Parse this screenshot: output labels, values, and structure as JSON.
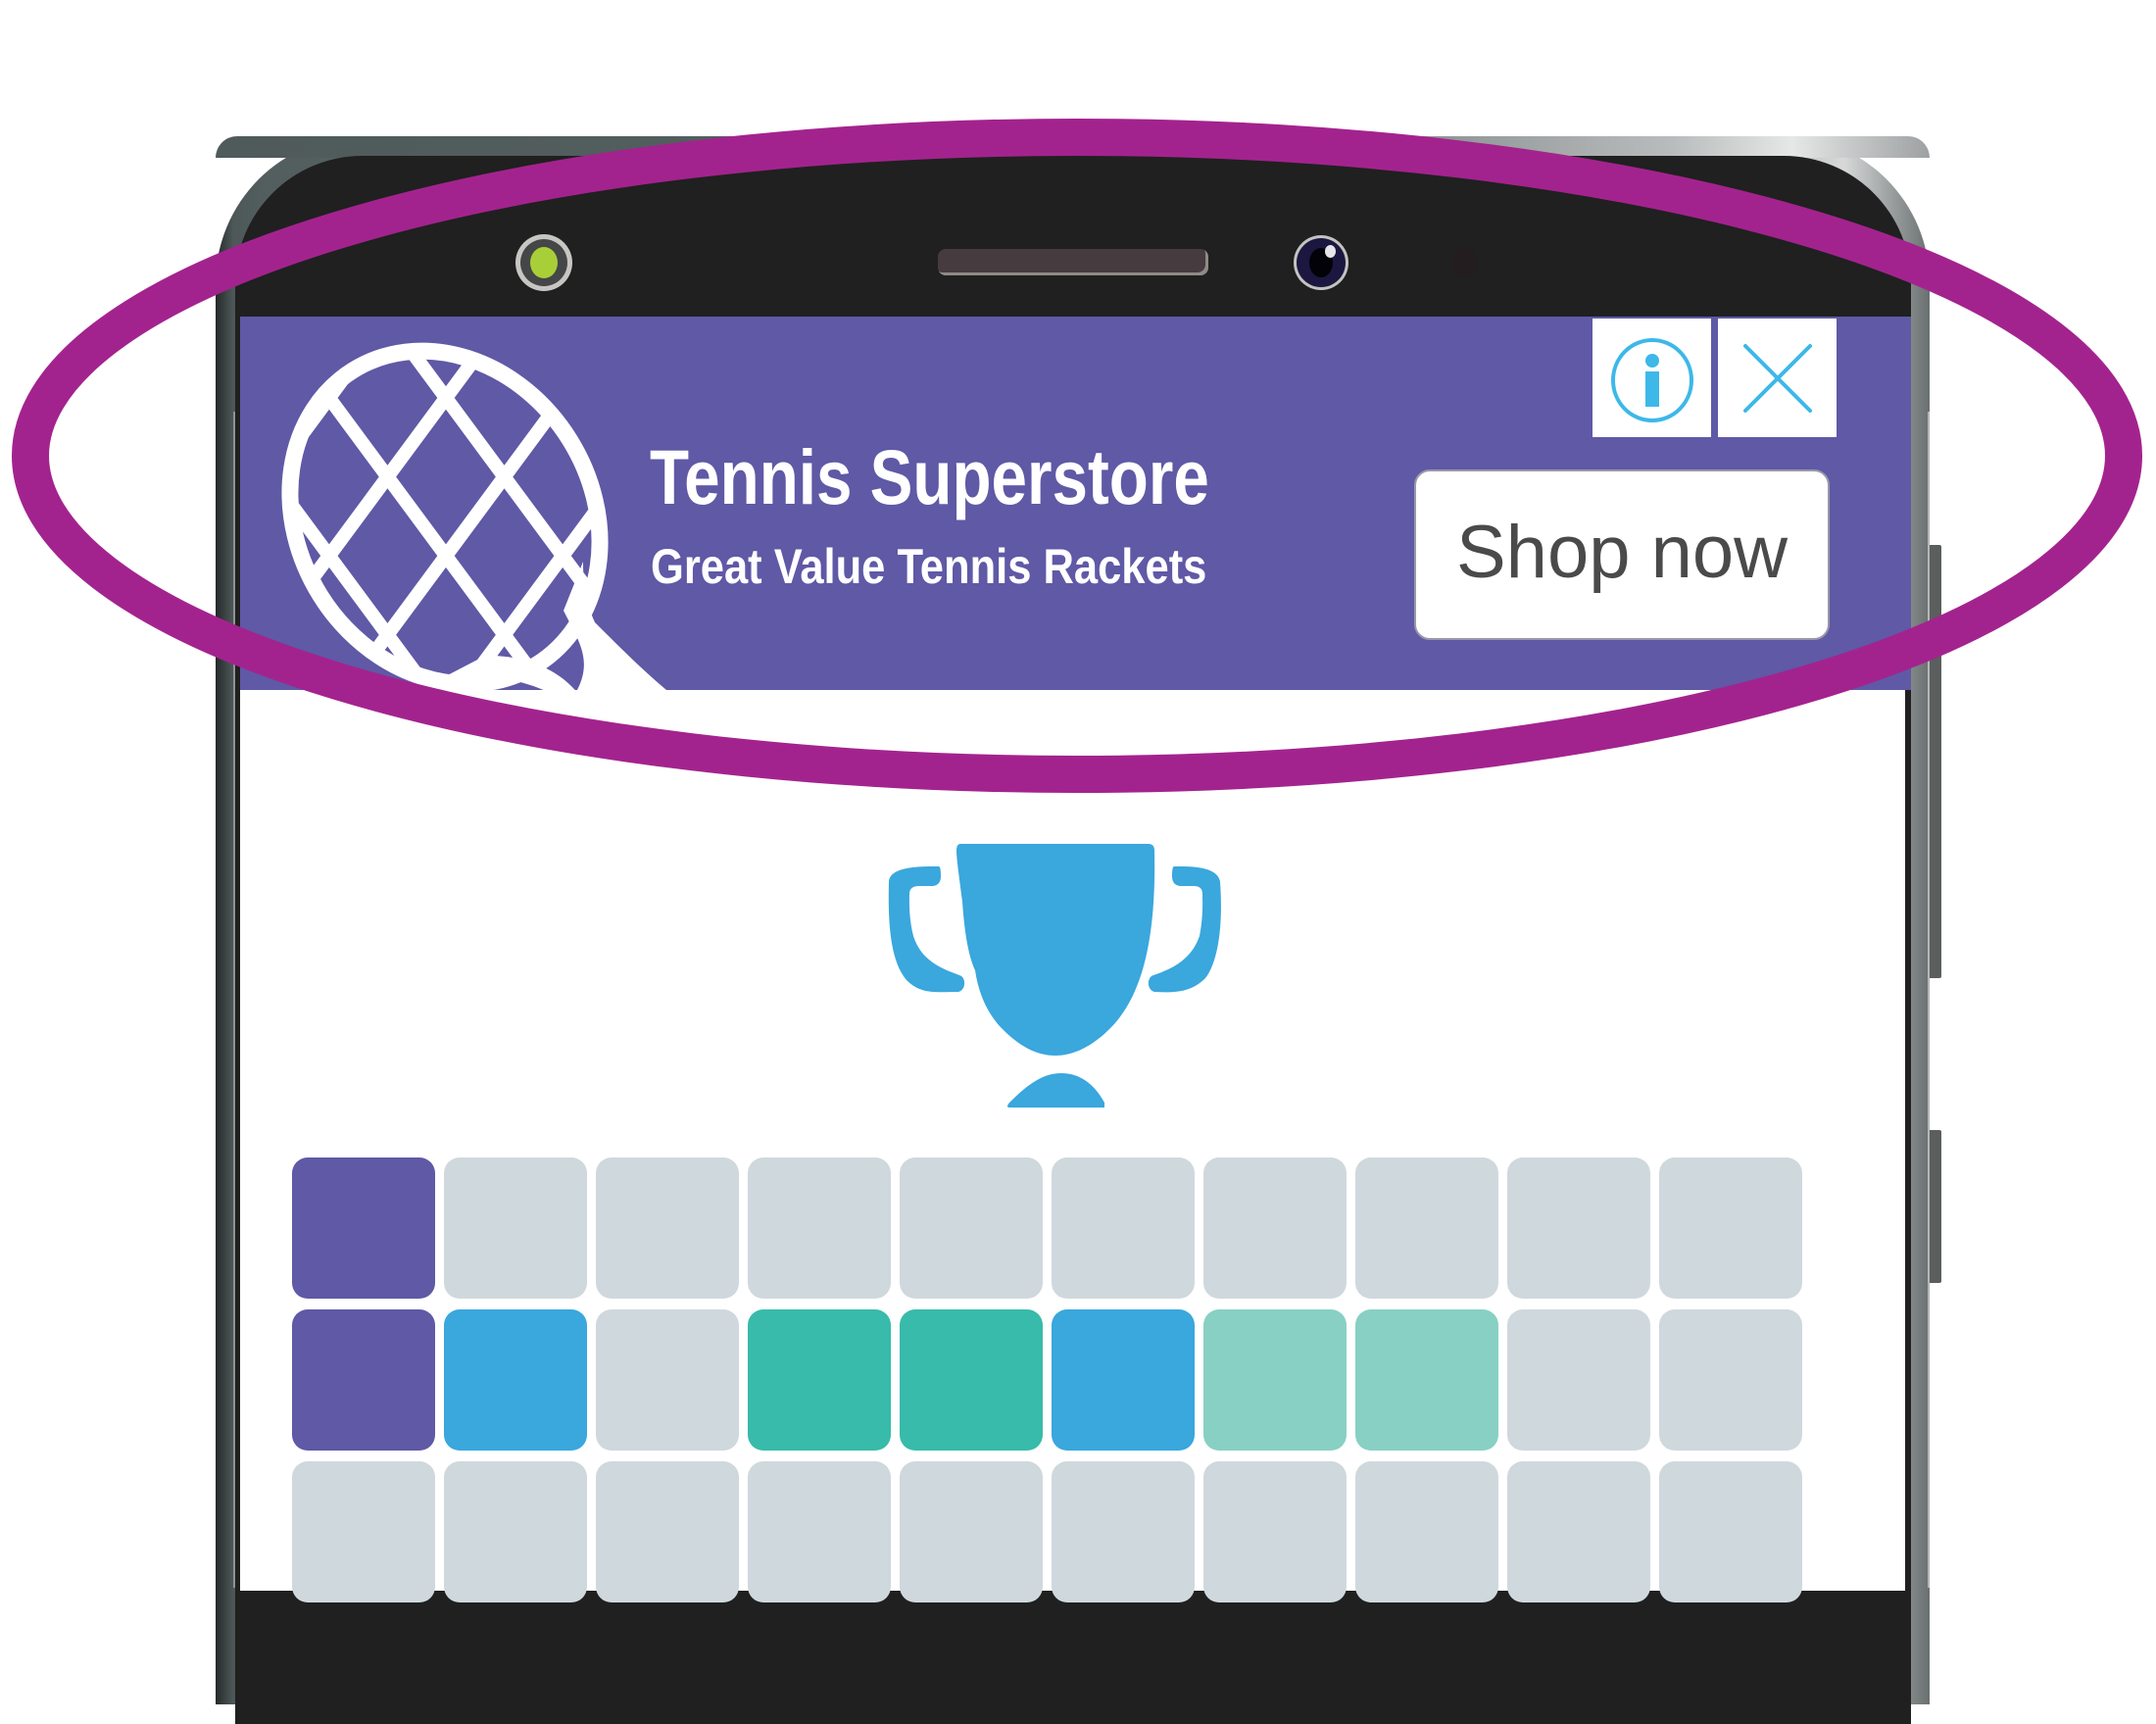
{
  "ad": {
    "title": "Tennis Superstore",
    "subtitle": "Great Value Tennis Rackets",
    "cta_label": "Shop now",
    "info_icon": "info-circle-icon",
    "close_icon": "close-x-icon",
    "logo_icon": "tennis-racket-icon"
  },
  "colors": {
    "banner_bg": "#5f59a6",
    "oval_highlight": "#a3238e",
    "icon_accent": "#3db8e8",
    "trophy": "#3aa7dd",
    "cta_text": "#4a4a4a",
    "cell_purple": "#5f59a6",
    "cell_blue": "#3aa7dd",
    "cell_teal": "#38bbaa",
    "cell_light_teal": "#88d0c4",
    "cell_empty": "#cfd8dd"
  },
  "content": {
    "trophy_icon": "trophy-icon",
    "grid": {
      "columns": 10,
      "rows": [
        [
          "cell_purple",
          "cell_empty",
          "cell_empty",
          "cell_empty",
          "cell_empty",
          "cell_empty",
          "cell_empty",
          "cell_empty",
          "cell_empty",
          "cell_empty"
        ],
        [
          "cell_purple",
          "cell_blue",
          "cell_empty",
          "cell_teal",
          "cell_teal",
          "cell_blue",
          "cell_light_teal",
          "cell_light_teal",
          "cell_empty",
          "cell_empty"
        ],
        [
          "cell_empty",
          "cell_empty",
          "cell_empty",
          "cell_empty",
          "cell_empty",
          "cell_empty",
          "cell_empty",
          "cell_empty",
          "cell_empty",
          "cell_empty"
        ]
      ]
    }
  },
  "device": {
    "bezel_icons": [
      "ambient-light-sensor-icon",
      "earpiece-speaker-icon",
      "front-camera-icon",
      "proximity-sensor-icon"
    ]
  }
}
